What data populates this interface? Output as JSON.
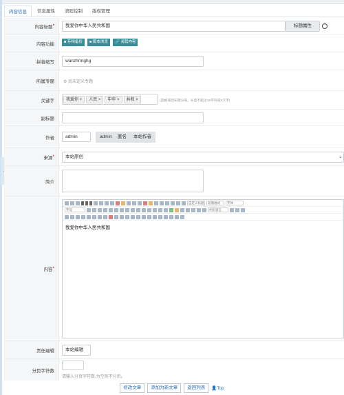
{
  "tabs": [
    "内容信息",
    "信息属性",
    "流程控制",
    "版权管理"
  ],
  "form": {
    "title": {
      "label": "内容标题",
      "value": "我爱你中华人民共和国",
      "attr_button": "标题属性"
    },
    "function": {
      "label": "内容功能",
      "buttons": [
        "存档备份",
        "版本浏览",
        "关联内容"
      ]
    },
    "pinyin": {
      "label": "拼音缩写",
      "value": "wanzhrmghg"
    },
    "topic": {
      "label": "所属专题",
      "placeholder": "尚未定义专题"
    },
    "keywords": {
      "label": "关键字",
      "tags": [
        "我爱你",
        "人民",
        "中华",
        "共和"
      ],
      "hint": "(空格或回车键分隔，长度不超过15字符或5汉字)"
    },
    "subtitle": {
      "label": "副标题",
      "value": ""
    },
    "author": {
      "label": "作者",
      "value": "admin",
      "options": [
        "admin",
        "匿名",
        "本站作者"
      ]
    },
    "source": {
      "label": "来源",
      "value": "本站原创"
    },
    "summary": {
      "label": "简介",
      "value": ""
    },
    "content": {
      "label": "内容",
      "value": "我爱你中华人民共和国",
      "font_select": "字号",
      "font_family": "自定义标题",
      "para_format": "段落格式",
      "font": "字体",
      "code_lang": "代码语言"
    },
    "editor": {
      "label": "责任编辑",
      "value": "本站编辑"
    },
    "paging": {
      "label": "分页字符数",
      "value": "",
      "hint": "请输入分页字符数,为空则不分页。"
    }
  },
  "actions": [
    "修改文章",
    "添加为新文章",
    "返回列表",
    "Top"
  ],
  "colors": {
    "teal": "#3a8d96",
    "link": "#2a6db3"
  }
}
